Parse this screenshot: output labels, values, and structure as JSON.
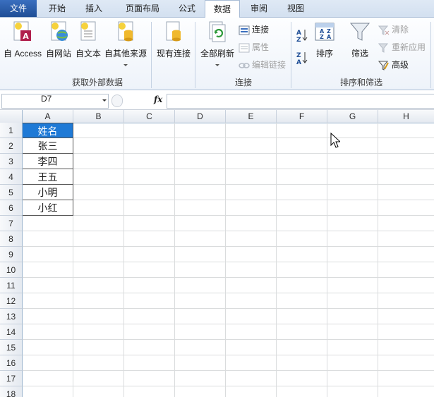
{
  "tabs": [
    {
      "label": "文件"
    },
    {
      "label": "开始"
    },
    {
      "label": "插入"
    },
    {
      "label": "页面布局"
    },
    {
      "label": "公式"
    },
    {
      "label": "数据"
    },
    {
      "label": "审阅"
    },
    {
      "label": "视图"
    }
  ],
  "ribbon": {
    "get_external": {
      "label": "获取外部数据",
      "access": "自 Access",
      "web": "自网站",
      "text": "自文本",
      "other": "自其他来源"
    },
    "existing": "现有连接",
    "connections": {
      "label": "连接",
      "refresh_all": "全部刷新",
      "connections": "连接",
      "properties": "属性",
      "edit_links": "编辑链接"
    },
    "sort_filter": {
      "label": "排序和筛选",
      "sort": "排序",
      "filter": "筛选",
      "clear": "清除",
      "reapply": "重新应用",
      "advanced": "高级"
    }
  },
  "formula_bar": {
    "name_box": "D7",
    "fx": "fx",
    "value": ""
  },
  "columns": [
    "A",
    "B",
    "C",
    "D",
    "E",
    "F",
    "G",
    "H"
  ],
  "rows": [
    "1",
    "2",
    "3",
    "4",
    "5",
    "6",
    "7",
    "8",
    "9",
    "10",
    "11",
    "12",
    "13",
    "14",
    "15",
    "16",
    "17",
    "18"
  ],
  "cells": [
    "姓名",
    "张三",
    "李四",
    "王五",
    "小明",
    "小红"
  ],
  "colors": {
    "header_fill": "#1f7ad6",
    "file_tab": "#2b579a"
  }
}
